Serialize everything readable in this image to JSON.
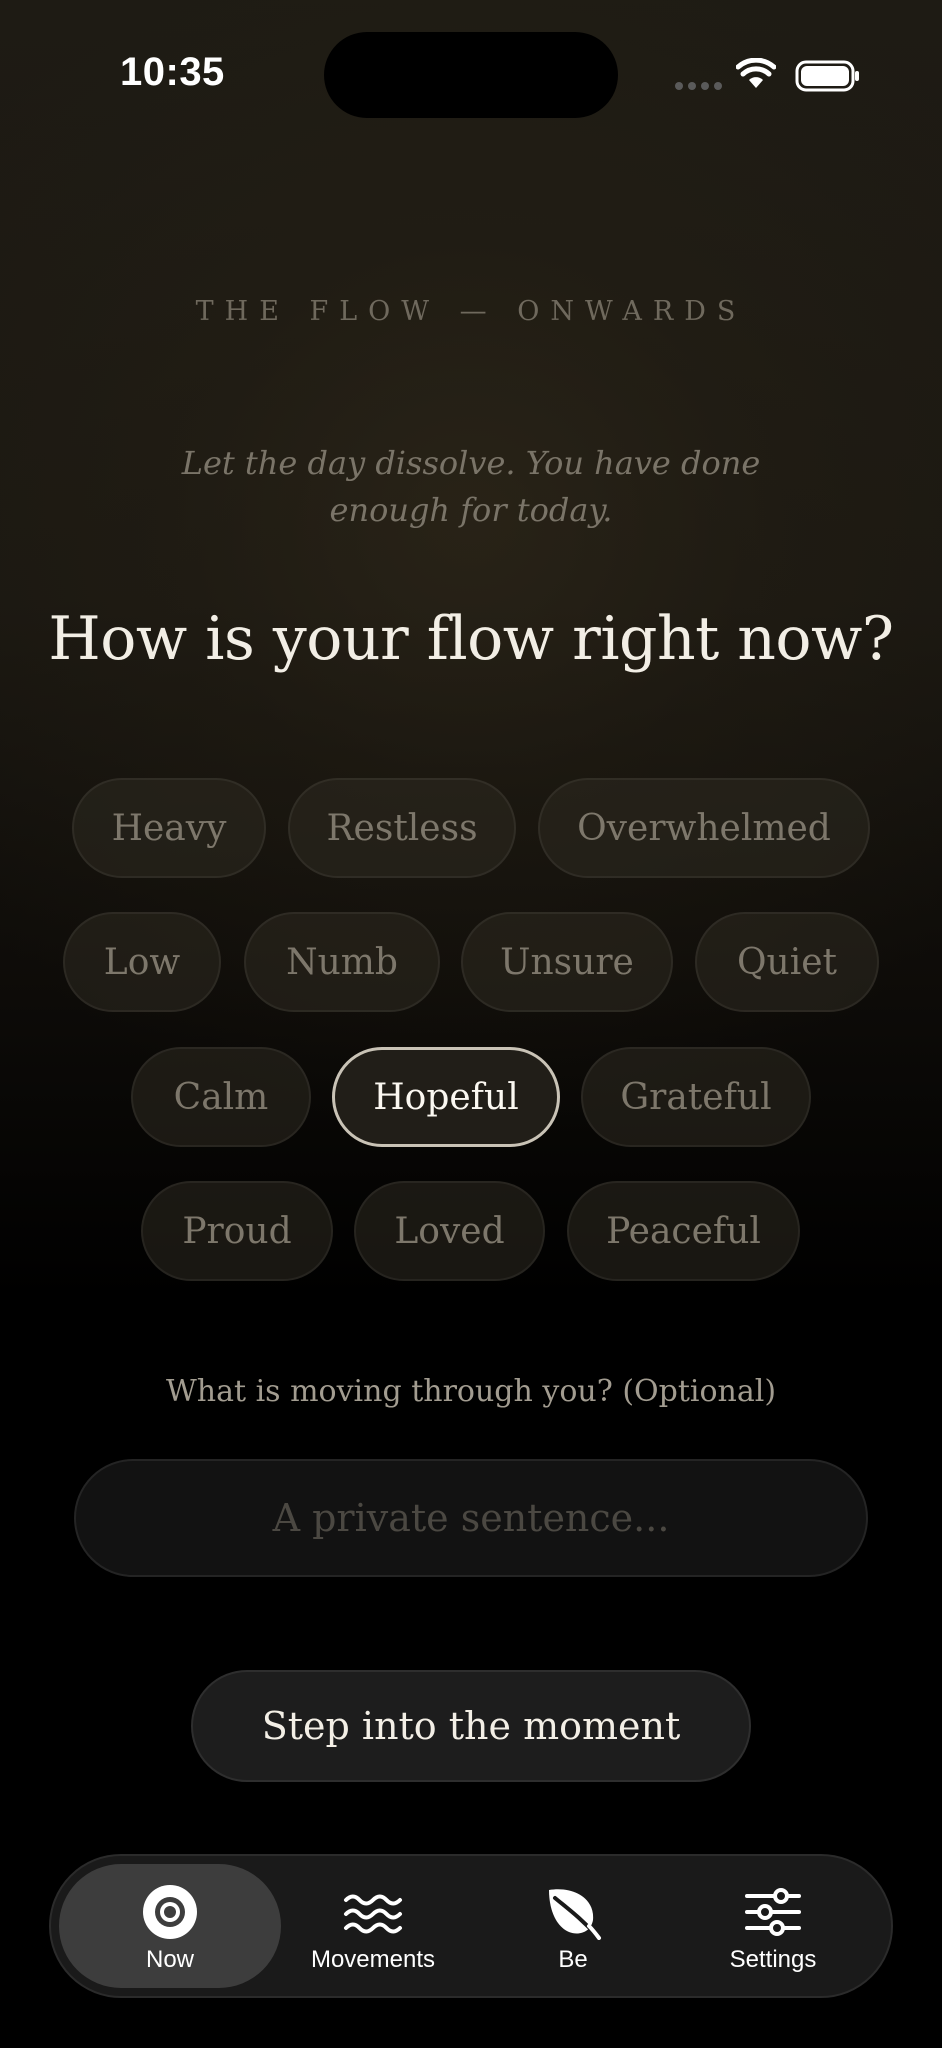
{
  "status_bar": {
    "time": "10:35"
  },
  "header": {
    "eyebrow": "THE FLOW — ONWARDS",
    "subtitle": "Let the day dissolve. You have done enough for today.",
    "question": "How is your flow right now?"
  },
  "moods": [
    {
      "label": "Heavy",
      "selected": false
    },
    {
      "label": "Restless",
      "selected": false
    },
    {
      "label": "Overwhelmed",
      "selected": false
    },
    {
      "label": "Low",
      "selected": false
    },
    {
      "label": "Numb",
      "selected": false
    },
    {
      "label": "Unsure",
      "selected": false
    },
    {
      "label": "Quiet",
      "selected": false
    },
    {
      "label": "Calm",
      "selected": false
    },
    {
      "label": "Hopeful",
      "selected": true
    },
    {
      "label": "Grateful",
      "selected": false
    },
    {
      "label": "Proud",
      "selected": false
    },
    {
      "label": "Loved",
      "selected": false
    },
    {
      "label": "Peaceful",
      "selected": false
    }
  ],
  "note": {
    "label": "What is moving through you? (Optional)",
    "placeholder": "A private sentence...",
    "value": ""
  },
  "cta": {
    "label": "Step into the moment"
  },
  "tabs": [
    {
      "label": "Now",
      "icon": "circle-target-icon",
      "active": true
    },
    {
      "label": "Movements",
      "icon": "waves-icon",
      "active": false
    },
    {
      "label": "Be",
      "icon": "leaf-icon",
      "active": false
    },
    {
      "label": "Settings",
      "icon": "sliders-icon",
      "active": false
    }
  ]
}
